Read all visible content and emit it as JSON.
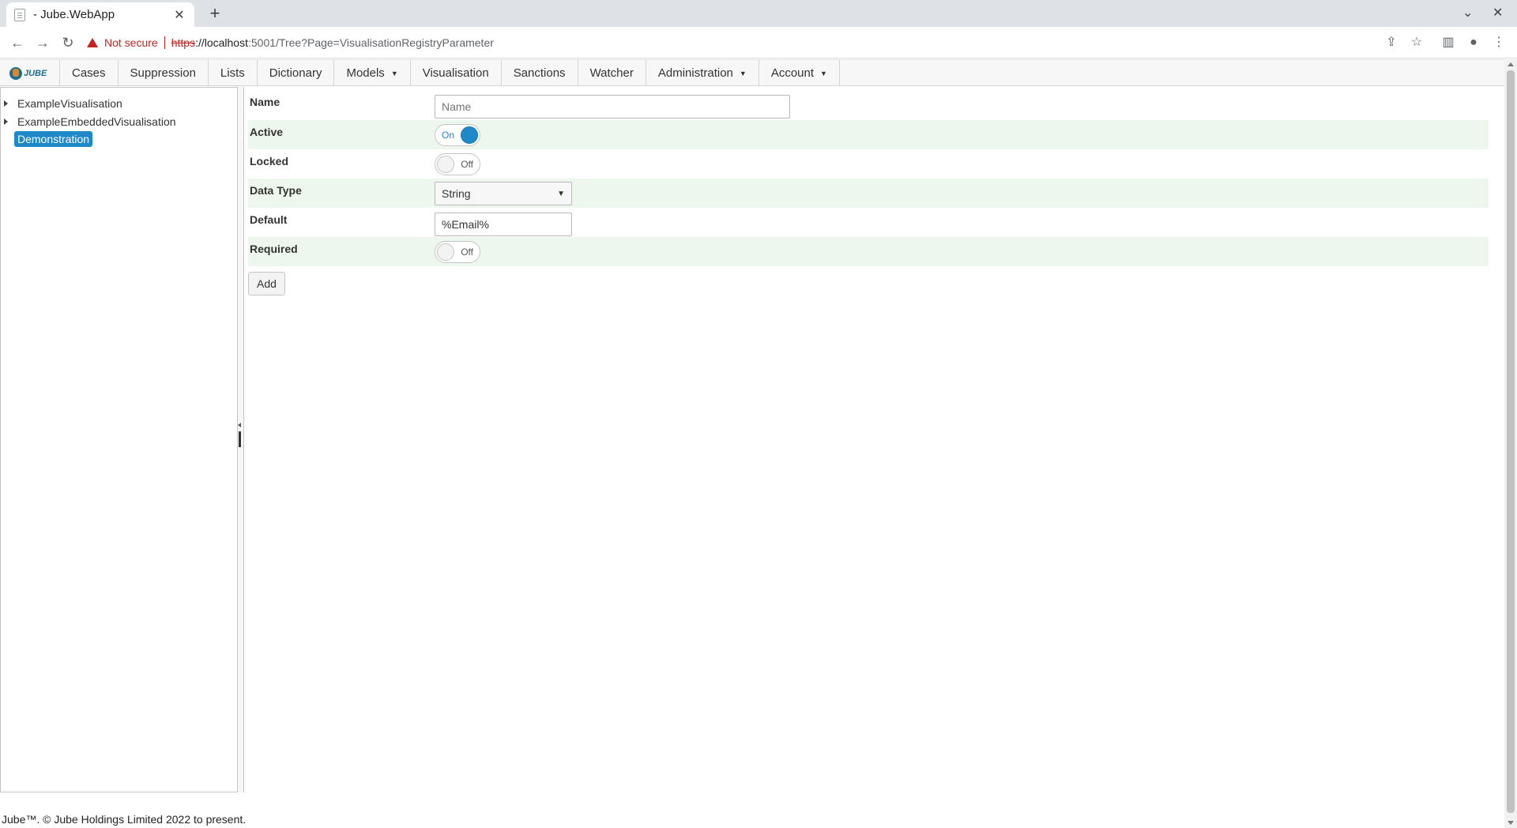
{
  "browser": {
    "tab_title": "- Jube.WebApp",
    "not_secure_label": "Not secure",
    "url_protocol": "https",
    "url_host": "://localhost",
    "url_rest": ":5001/Tree?Page=VisualisationRegistryParameter"
  },
  "nav": {
    "logo_text": "JUBE",
    "items": [
      {
        "label": "Cases"
      },
      {
        "label": "Suppression"
      },
      {
        "label": "Lists"
      },
      {
        "label": "Dictionary"
      },
      {
        "label": "Models",
        "dropdown": true
      },
      {
        "label": "Visualisation"
      },
      {
        "label": "Sanctions"
      },
      {
        "label": "Watcher"
      },
      {
        "label": "Administration",
        "dropdown": true
      },
      {
        "label": "Account",
        "dropdown": true
      }
    ]
  },
  "tree": {
    "nodes": [
      {
        "label": "ExampleVisualisation",
        "expandable": true
      },
      {
        "label": "ExampleEmbeddedVisualisation",
        "expandable": true
      },
      {
        "label": "Demonstration",
        "selected": true
      }
    ]
  },
  "form": {
    "name": {
      "label": "Name",
      "placeholder": "Name",
      "value": ""
    },
    "active": {
      "label": "Active",
      "state": "On",
      "checked": true
    },
    "locked": {
      "label": "Locked",
      "state": "Off",
      "checked": false
    },
    "data_type": {
      "label": "Data Type",
      "value": "String"
    },
    "default": {
      "label": "Default",
      "value": "%Email%"
    },
    "required": {
      "label": "Required",
      "state": "Off",
      "checked": false
    },
    "add_label": "Add"
  },
  "footer": {
    "text": "Jube™. © Jube Holdings Limited 2022 to present."
  },
  "colors": {
    "accent": "#1e88c8",
    "row_highlight": "#edf7ed",
    "warning": "#c5221f"
  }
}
